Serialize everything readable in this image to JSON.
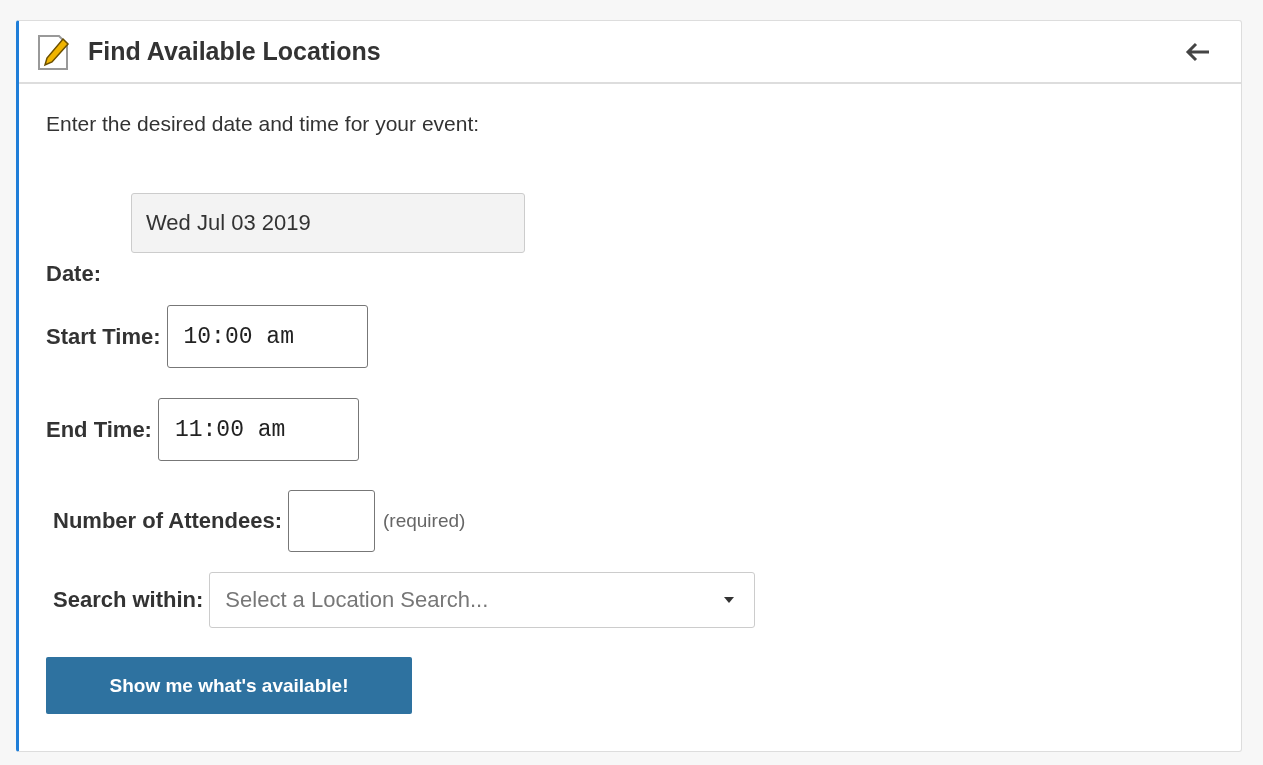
{
  "panel": {
    "title": "Find Available Locations"
  },
  "intro": "Enter the desired date and time for your event:",
  "date": {
    "label": "Date:",
    "value": "Wed Jul 03 2019",
    "disabled": true
  },
  "start_time": {
    "label": "Start Time:",
    "value": "10:00 am"
  },
  "end_time": {
    "label": "End Time:",
    "value": "11:00 am"
  },
  "attendees": {
    "label": "Number of Attendees:",
    "note": "(required)"
  },
  "search_within": {
    "label": "Search within:",
    "placeholder": "Select a Location Search..."
  },
  "submit_button": "Show me what's available!"
}
